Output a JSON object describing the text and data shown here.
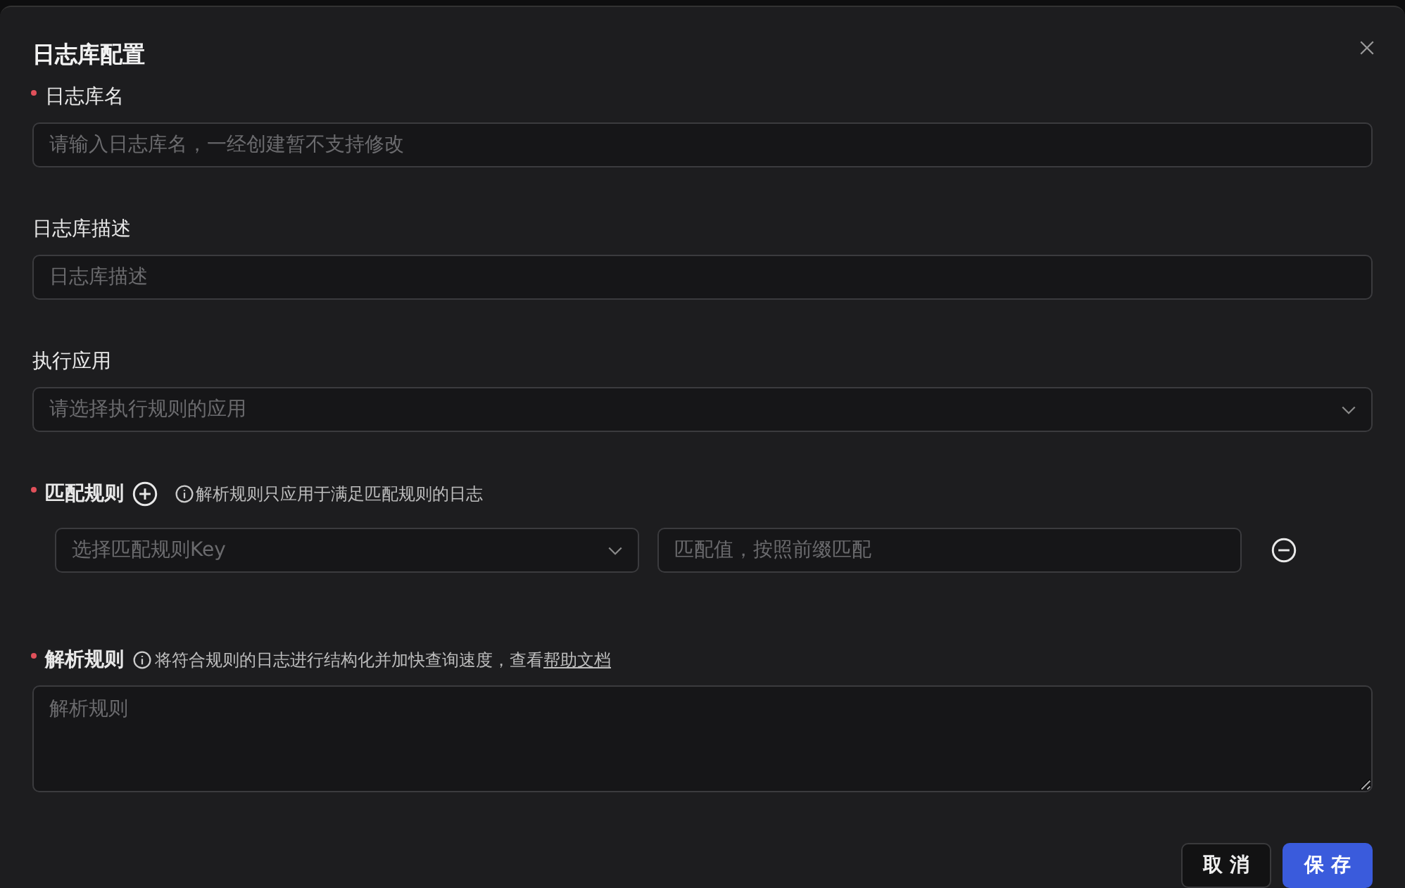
{
  "dialog": {
    "title": "日志库配置"
  },
  "fields": [
    {
      "kind": "input",
      "label": "日志库名",
      "required": true,
      "placeholder": "请输入日志库名，一经创建暂不支持修改"
    },
    {
      "kind": "input",
      "label": "日志库描述",
      "required": false,
      "placeholder": "日志库描述"
    },
    {
      "kind": "select",
      "label": "执行应用",
      "required": false,
      "placeholder": "请选择执行规则的应用"
    }
  ],
  "match_rules": {
    "label": "匹配规则",
    "required": true,
    "hint": "解析规则只应用于满足匹配规则的日志",
    "rows": [
      {
        "key_placeholder": "选择匹配规则Key",
        "value_placeholder": "匹配值，按照前缀匹配"
      }
    ]
  },
  "parse_rules": {
    "label": "解析规则",
    "required": true,
    "hint": "将符合规则的日志进行结构化并加快查询速度，查看",
    "help_link": "帮助文档",
    "placeholder": "解析规则"
  },
  "buttons": [
    {
      "label": "取 消",
      "kind": "secondary"
    },
    {
      "label": "保 存",
      "kind": "primary"
    }
  ]
}
